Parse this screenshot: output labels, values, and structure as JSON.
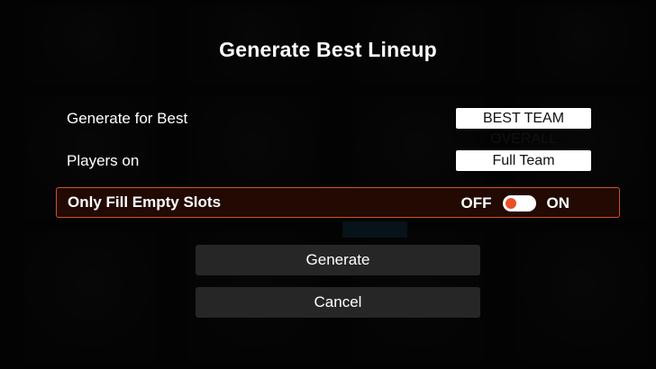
{
  "dialog": {
    "title": "Generate Best Lineup"
  },
  "options": [
    {
      "label": "Generate for Best",
      "value": "BEST TEAM OVERALL"
    },
    {
      "label": "Players on",
      "value": "Full Team"
    }
  ],
  "fill_empty": {
    "label": "Only Fill Empty Slots",
    "off_label": "OFF",
    "on_label": "ON",
    "state": "off",
    "accent_color": "#e8502a"
  },
  "buttons": {
    "generate_label": "Generate",
    "cancel_label": "Cancel"
  }
}
